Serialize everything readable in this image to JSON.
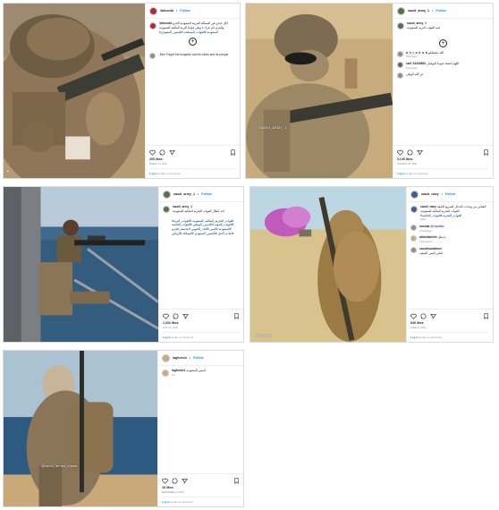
{
  "common": {
    "follow_label": "Follow",
    "dot": "•",
    "login_prefix": "Log in",
    "login_suffix": "to like or comment."
  },
  "posts": [
    {
      "username": "3ahoodd",
      "caption_user": "3ahoodd",
      "caption": "ﻟﻜﻞ ﺟﻨﺪﻱ ﻓﻲ ﺍﻟﻤﻤﻠﻜﺔ ﺍﻟﻌﺮﺑﻴﺔ ﺍﻟﺴﻌﻮﺩﻳﺔ ﺍﻟﺤﺰﻡ ﻭﺍﻟﻌﺰﻡ ﺩﺍﻡ ﻋﺰﻙ ﻳﺎ ﻭﻃﻦ ﻗﻮﺍﺗﻨﺎ ﺍﻟﺒﺮﻳﺔ ﺍﻟﻤﻠﻜﻴﺔ ﺍﻟﺴﻌﻮﺩﻳﺔ",
      "hashtags": "#ﺍﻟﺴﻌﻮﺩﻳﺔ #ﺍﻟﻘﻮﺍﺕ_ﺍﻟﻤﺴﻠﺤﺔ #ﺍﻟﺠﻴﺶ_ﺍﻟﺴﻌﻮﺩﻱ",
      "comment_user": "",
      "comment": "..Bee Forget the kingdom and its rulers and its people",
      "likes": "405 likes",
      "date": "March 14, 2019",
      "colors": {
        "av": "red"
      }
    },
    {
      "username": "saudi_army_1",
      "caption_user": "saudi_army_1",
      "caption": "ﺍﺳﺪ ﺍﻟﻘﻮﺍﺕ ﺍﻟﺒﺮﻳﺔ ﺍﻟﺴﻌﻮﺩﻳﺔ",
      "hashtags": "",
      "comments": [
        {
          "user": "a_h_r_a_h_a_b",
          "text": "ﺍﻟﻠﻪ ﻳﺤﻔﻈﻜﻢ",
          "meta": "51w  Reply"
        },
        {
          "user": "saif_04440852",
          "text": "ﺍﻟﻠﻬﻢ ﺍﺣﻔﻆ ﺟﻨﻮﺩﻧﺎ ﺍﻟﺒﻮﺍﺳﻞ",
          "meta": "51w  Reply"
        },
        {
          "user": "",
          "text": "ﻋﺰ ﺍﻟﻠﻪ ﺍﻟﻮﻃﻦ",
          "meta": ""
        }
      ],
      "likes": "3,149 likes",
      "date": "January 25, 2018",
      "watermark": "SAWDI_ARMY_1",
      "colors": {
        "av": "green"
      }
    },
    {
      "username": "saudi_army_1",
      "caption_user": "saudi_army_1",
      "caption": "ﺍﺣﺪ ﺍﺑﻄﺎﻝ ﺍﻟﻘﻮﺍﺕ ﺍﻟﺒﺤﺮﻳﺔ ﺍﻟﻤﻠﻜﻴﺔ ﺍﻟﺴﻌﻮﺩﻳﺔ",
      "hashtags": "#ﺍﻟﻘﻮﺍﺕ_ﺍﻟﺒﺤﺮﻳﺔ_ﺍﻟﻤﻠﻜﻴﺔ_ﺍﻟﺴﻌﻮﺩﻳﺔ #ﺍﻟﻘﻮﺍﺕ_ﺍﻟﺒﺮﻳﺔ #ﺍﻟﻘﻮﺍﺕ_ﺍﻟﺠﻮﻳﺔ #ﺍﻟﺤﺮﺱ_ﺍﻟﻮﻃﻨﻲ #ﺍﻟﻘﻮﺍﺕ_ﺍﻟﺨﺎﺻﺔ #ﺍﻟﺴﻌﻮﺩﻳﺔ #ﺍﻟﻴﻤﻦ #ﺍﻟﺤﺪ_ﺍﻟﺠﻨﻮﺑﻲ #ﻋﺎﺻﻔﺔ_ﺍﻟﺤﺰﻡ #ﺍﻋﺎﺩﺓ_ﺍﻻﻣﻞ #ﺍﻟﺠﻴﺶ_ﺍﻟﺴﻌﻮﺩﻱ #ﺍﻟﻤﻤﻠﻜﺔ #ﺍﻟﺮﻳﺎﺽ",
      "likes": "1,334 likes",
      "date": "July 24, 2018",
      "colors": {
        "av": "green"
      }
    },
    {
      "username": "saudi_navy",
      "caption_user": "saudi_navy",
      "caption": "ﺍﻟﻘﻨﺎﺹ ﻣﻦ ﻭﺣﺪﺍﺕ ﺍﻟﺘﺪﺧﻞ ﺍﻟﺴﺮﻳﻊ ﺍﻟﺘﺎﺑﻌﺔ ﻟﻠﻘﻮﺍﺕ ﺍﻟﺒﺤﺮﻳﺔ ﺍﻟﻤﻠﻜﻴﺔ ﺍﻟﺴﻌﻮﺩﻳﺔ",
      "hashtags": "#ﺍﻟﻘﻮﺍﺕ_ﺍﻟﺒﺤﺮﻳﺔ #ﺍﻟﻘﻮﺍﺕ_ﺍﻟﺨﺎﺻﺔ",
      "caption_meta": "185w",
      "comments": [
        {
          "user": "rowsaa",
          "text": "@royalkkk",
          "meta": "174w  Reply"
        },
        {
          "user": "abdullahhhh",
          "text": "ﻳﺎ ﺑﻄﻞ",
          "meta": "174w  Reply"
        },
        {
          "user": "saudimodaliiner",
          "text": "ﻗﻨﺎﺹ ﺍﻟﻴﻤﻦ ﺍﻟﺴﻌﻴﺪ",
          "meta": ""
        }
      ],
      "likes": "649 likes",
      "date": "June 23, 2019",
      "watermark": "saudi_navy",
      "colors": {
        "av": "blue"
      }
    },
    {
      "username": "lagfueshi",
      "caption_user": "lagfuesh1",
      "caption": "ﺍﺣﺒﻴﺒﻲ ﺍﻟﺴﻌﻮﺩﻳﺔ",
      "caption_meta": "3w",
      "likes": "16 likes",
      "date": "December 14, 2018",
      "watermark": "@saudi_armed_forces",
      "colors": {
        "av": "sand"
      }
    }
  ]
}
